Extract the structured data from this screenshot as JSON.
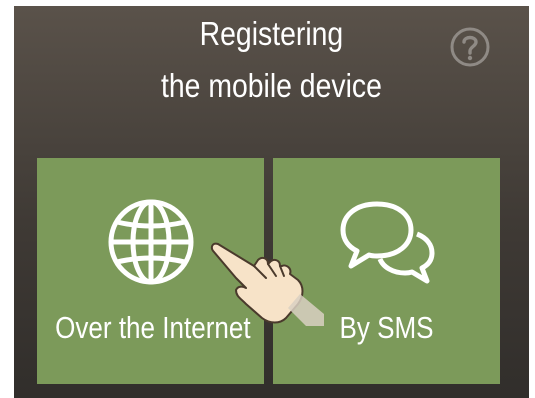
{
  "header": {
    "title_line1": "Registering",
    "title_line2": "the mobile device",
    "help_icon": "question-circle-icon"
  },
  "options": {
    "internet": {
      "label": "Over the Internet",
      "icon": "globe-icon"
    },
    "sms": {
      "label": "By SMS",
      "icon": "chat-bubbles-icon"
    }
  },
  "overlay": {
    "pointer_icon": "pointing-hand-icon"
  },
  "colors": {
    "background": "#3f3a35",
    "tile": "#7c9a5a",
    "text": "#ffffff"
  }
}
